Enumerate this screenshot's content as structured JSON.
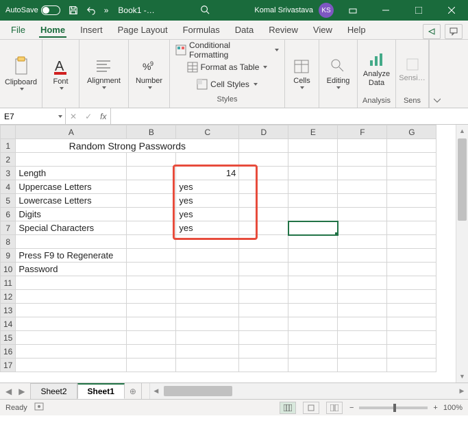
{
  "titlebar": {
    "autosave_label": "AutoSave",
    "autosave_state": "Off",
    "doc_name": "Book1 -…",
    "username": "Komal Srivastava",
    "initials": "KS"
  },
  "tabs": {
    "file": "File",
    "items": [
      "Home",
      "Insert",
      "Page Layout",
      "Formulas",
      "Data",
      "Review",
      "View",
      "Help"
    ],
    "active": "Home"
  },
  "ribbon": {
    "clipboard": "Clipboard",
    "font": "Font",
    "alignment": "Alignment",
    "number": "Number",
    "cond_fmt": "Conditional Formatting",
    "fmt_table": "Format as Table",
    "cell_styles": "Cell Styles",
    "styles": "Styles",
    "cells": "Cells",
    "editing": "Editing",
    "analyze": "Analyze Data",
    "analysis": "Analysis",
    "sens": "Sensi…",
    "sens_group": "Sens"
  },
  "formula_bar": {
    "namebox": "E7",
    "formula": ""
  },
  "grid": {
    "columns": [
      "A",
      "B",
      "C",
      "D",
      "E",
      "F",
      "G"
    ],
    "rows": [
      "1",
      "2",
      "3",
      "4",
      "5",
      "6",
      "7",
      "8",
      "9",
      "10",
      "11",
      "12",
      "13",
      "14",
      "15",
      "16",
      "17"
    ],
    "title": "Random Strong Passwords",
    "labels": {
      "length": "Length",
      "upper": "Uppercase Letters",
      "lower": "Lowercase Letters",
      "digits": "Digits",
      "special": "Special Characters",
      "regen": "Press F9 to Regenerate",
      "password": "Password"
    },
    "values": {
      "length": "14",
      "upper": "yes",
      "lower": "yes",
      "digits": "yes",
      "special": "yes"
    },
    "active_cell": "E7"
  },
  "sheets": {
    "items": [
      "Sheet2",
      "Sheet1"
    ],
    "active": "Sheet1"
  },
  "status": {
    "ready": "Ready",
    "zoom": "100%"
  }
}
